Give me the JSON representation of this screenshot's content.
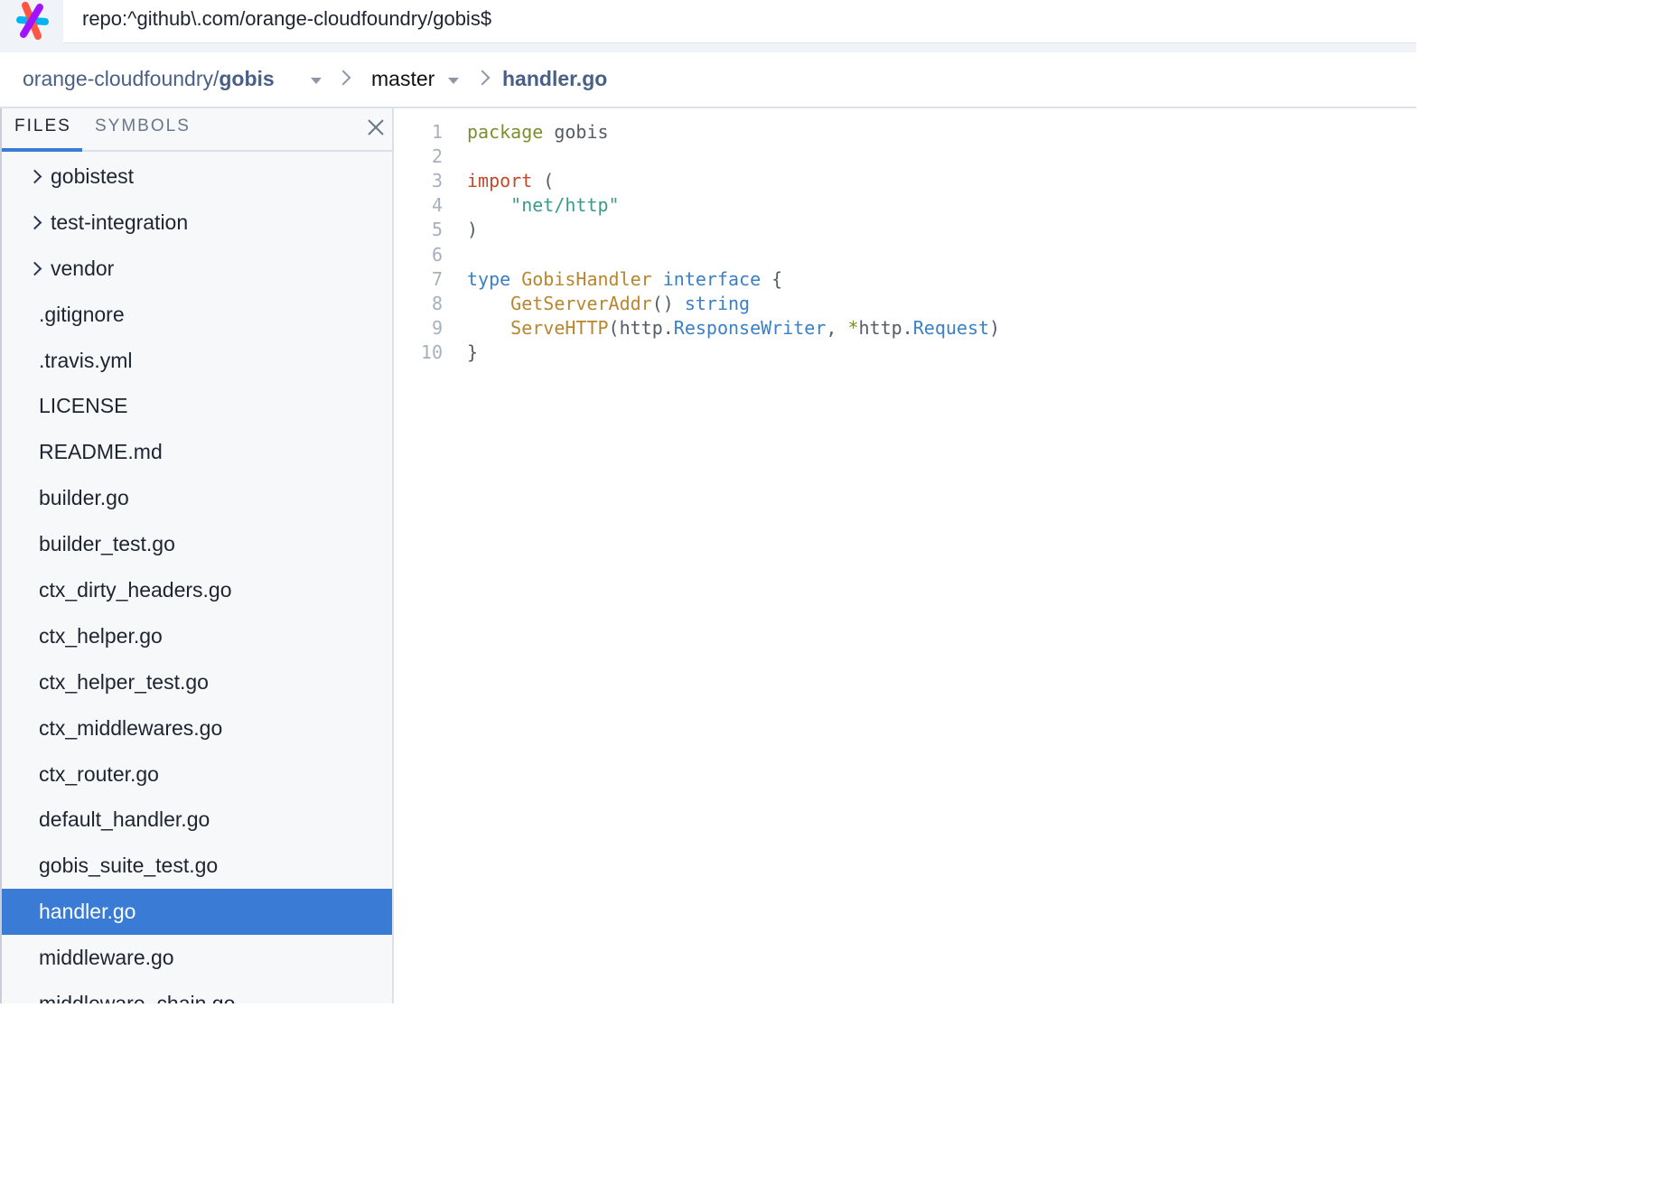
{
  "search": {
    "query": "repo:^github\\.com/orange-cloudfoundry/gobis$"
  },
  "breadcrumb": {
    "repo_owner": "orange-cloudfoundry/",
    "repo_name": "gobis",
    "branch": "master",
    "file": "handler.go"
  },
  "sidebar": {
    "tabs": {
      "files": "FILES",
      "symbols": "SYMBOLS"
    },
    "active_tab": "FILES",
    "items": [
      {
        "label": "gobistest",
        "type": "folder"
      },
      {
        "label": "test-integration",
        "type": "folder"
      },
      {
        "label": "vendor",
        "type": "folder"
      },
      {
        "label": ".gitignore",
        "type": "file"
      },
      {
        "label": ".travis.yml",
        "type": "file"
      },
      {
        "label": "LICENSE",
        "type": "file"
      },
      {
        "label": "README.md",
        "type": "file"
      },
      {
        "label": "builder.go",
        "type": "file"
      },
      {
        "label": "builder_test.go",
        "type": "file"
      },
      {
        "label": "ctx_dirty_headers.go",
        "type": "file"
      },
      {
        "label": "ctx_helper.go",
        "type": "file"
      },
      {
        "label": "ctx_helper_test.go",
        "type": "file"
      },
      {
        "label": "ctx_middlewares.go",
        "type": "file"
      },
      {
        "label": "ctx_router.go",
        "type": "file"
      },
      {
        "label": "default_handler.go",
        "type": "file"
      },
      {
        "label": "gobis_suite_test.go",
        "type": "file"
      },
      {
        "label": "handler.go",
        "type": "file",
        "selected": true
      },
      {
        "label": "middleware.go",
        "type": "file"
      },
      {
        "label": "middleware_chain.go",
        "type": "file"
      }
    ]
  },
  "code": {
    "lines": [
      {
        "n": "1",
        "tokens": [
          {
            "t": "package",
            "c": "k-pkg"
          },
          {
            "t": " gobis",
            "c": "k-plain"
          }
        ]
      },
      {
        "n": "2",
        "tokens": []
      },
      {
        "n": "3",
        "tokens": [
          {
            "t": "import",
            "c": "k-imp"
          },
          {
            "t": " (",
            "c": "k-plain"
          }
        ]
      },
      {
        "n": "4",
        "tokens": [
          {
            "t": "    \"net/http\"",
            "c": "k-str"
          }
        ]
      },
      {
        "n": "5",
        "tokens": [
          {
            "t": ")",
            "c": "k-plain"
          }
        ]
      },
      {
        "n": "6",
        "tokens": []
      },
      {
        "n": "7",
        "tokens": [
          {
            "t": "type",
            "c": "k-blue"
          },
          {
            "t": " ",
            "c": "k-plain"
          },
          {
            "t": "GobisHandler",
            "c": "k-gold"
          },
          {
            "t": " ",
            "c": "k-plain"
          },
          {
            "t": "interface",
            "c": "k-blue"
          },
          {
            "t": " {",
            "c": "k-plain"
          }
        ]
      },
      {
        "n": "8",
        "tokens": [
          {
            "t": "    ",
            "c": "k-plain"
          },
          {
            "t": "GetServerAddr",
            "c": "k-gold"
          },
          {
            "t": "() ",
            "c": "k-plain"
          },
          {
            "t": "string",
            "c": "k-blue"
          }
        ]
      },
      {
        "n": "9",
        "tokens": [
          {
            "t": "    ",
            "c": "k-plain"
          },
          {
            "t": "ServeHTTP",
            "c": "k-gold"
          },
          {
            "t": "(http.",
            "c": "k-plain"
          },
          {
            "t": "ResponseWriter",
            "c": "k-blue"
          },
          {
            "t": ", ",
            "c": "k-plain"
          },
          {
            "t": "*",
            "c": "k-pkg"
          },
          {
            "t": "http.",
            "c": "k-plain"
          },
          {
            "t": "Request",
            "c": "k-blue"
          },
          {
            "t": ")",
            "c": "k-plain"
          }
        ]
      },
      {
        "n": "10",
        "tokens": [
          {
            "t": "}",
            "c": "k-plain"
          }
        ]
      }
    ]
  },
  "colors": {
    "accent": "#3a7bd5",
    "link": "#4a5f86"
  }
}
